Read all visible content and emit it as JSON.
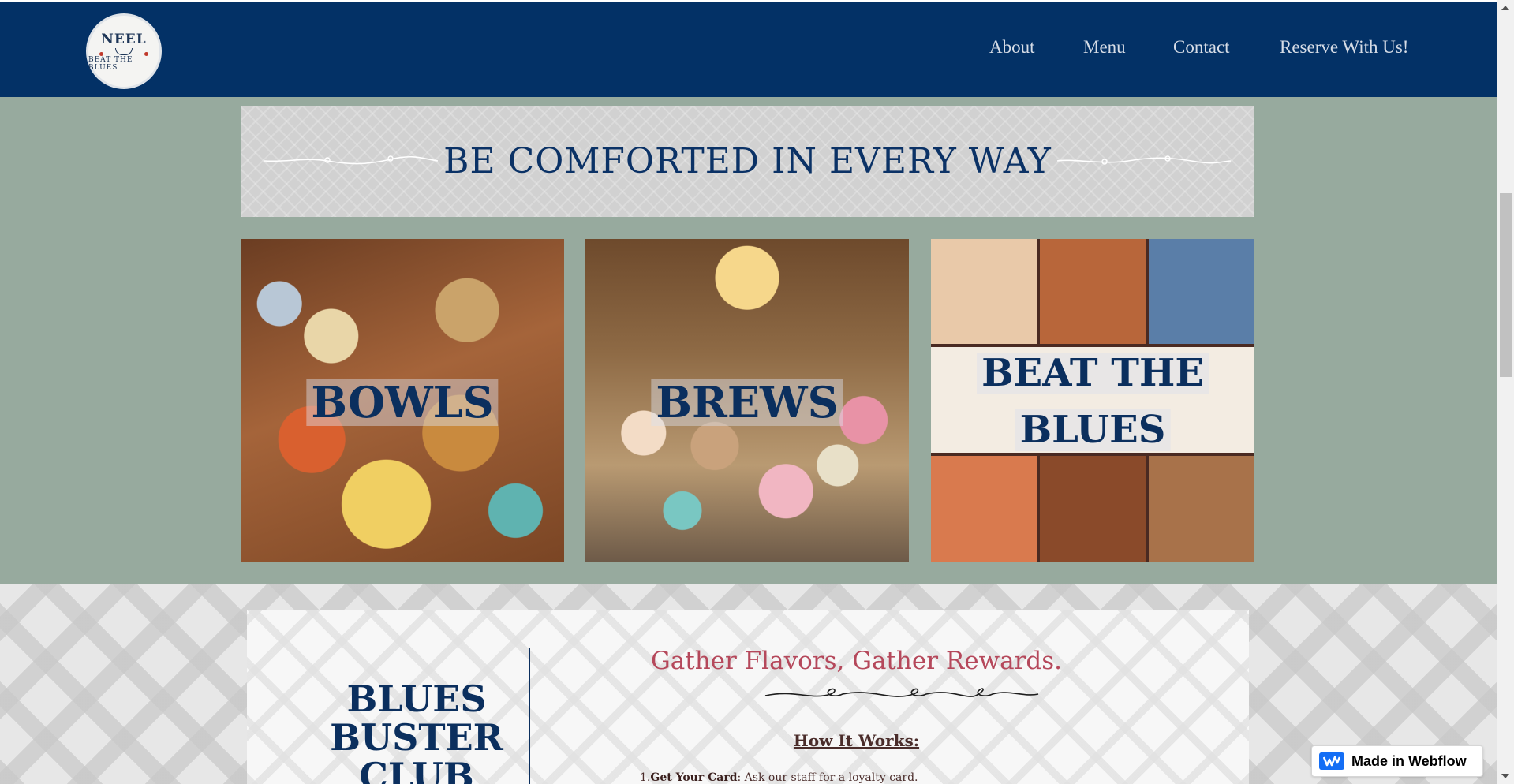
{
  "header": {
    "logo": {
      "brand": "NEEL",
      "tagline": "BEAT THE BLUES"
    },
    "nav": [
      {
        "label": "About"
      },
      {
        "label": "Menu"
      },
      {
        "label": "Contact"
      },
      {
        "label": "Reserve With Us!"
      }
    ]
  },
  "banner": {
    "title": "BE COMFORTED IN EVERY WAY"
  },
  "cards": [
    {
      "label": "BOWLS"
    },
    {
      "label": "BREWS"
    },
    {
      "label_line1": "BEAT THE",
      "label_line2": "BLUES"
    }
  ],
  "club": {
    "title": "BLUES BUSTER CLUB",
    "heading": "Gather Flavors, Gather Rewards.",
    "how_title": "How It Works:",
    "steps": [
      {
        "number": "1.",
        "title": "Get Your Card",
        "text": ": Ask our staff for a loyalty card."
      }
    ]
  },
  "badge": {
    "label": "Made in Webflow"
  },
  "colors": {
    "header_bg": "#033166",
    "sage": "#97aa9e",
    "navy_text": "#0b2f5e",
    "rose_heading": "#b5485b",
    "webflow_blue": "#146ef5"
  }
}
